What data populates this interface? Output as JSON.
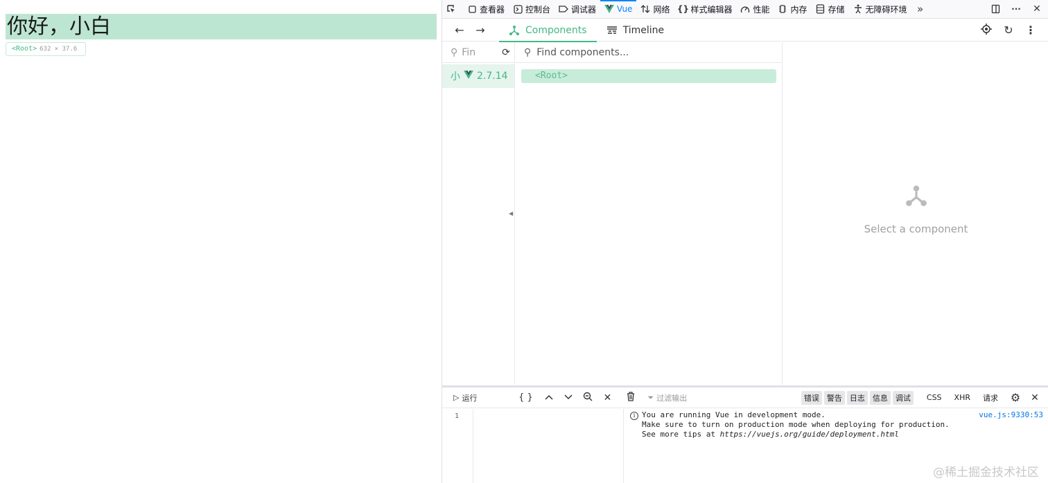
{
  "page": {
    "hello_text": "你好，小白",
    "tooltip": {
      "tag": "<Root>",
      "dims": "632 × 37.6"
    }
  },
  "toolbar": {
    "tabs": [
      {
        "label": "查看器",
        "icon": "inspector-icon"
      },
      {
        "label": "控制台",
        "icon": "console-icon"
      },
      {
        "label": "调试器",
        "icon": "debugger-icon"
      },
      {
        "label": "Vue",
        "icon": "vue-icon",
        "active": true
      },
      {
        "label": "网络",
        "icon": "network-icon"
      },
      {
        "label": "样式编辑器",
        "icon": "style-editor-icon"
      },
      {
        "label": "性能",
        "icon": "performance-icon"
      },
      {
        "label": "内存",
        "icon": "memory-icon"
      },
      {
        "label": "存储",
        "icon": "storage-icon"
      },
      {
        "label": "无障碍环境",
        "icon": "accessibility-icon"
      }
    ]
  },
  "vue_nav": {
    "tabs": [
      {
        "label": "Components",
        "active": true
      },
      {
        "label": "Timeline"
      }
    ]
  },
  "apps": {
    "search_placeholder": "Fin",
    "app_label": "小",
    "app_version": "2.7.14"
  },
  "tree": {
    "search_placeholder": "Find components...",
    "root_node": "<Root>"
  },
  "inspector": {
    "empty_text": "Select a component"
  },
  "console": {
    "run_label": "运行",
    "filter_placeholder": "过滤输出",
    "levels": [
      "错误",
      "警告",
      "日志",
      "信息",
      "调试"
    ],
    "extra_filters": [
      "CSS",
      "XHR",
      "请求"
    ],
    "line_number": "1",
    "message_lines": [
      "You are running Vue in development mode.",
      "Make sure to turn on production mode when deploying for production."
    ],
    "message_tip_prefix": "See more tips at ",
    "message_tip_url": "https://vuejs.org/guide/deployment.html",
    "source": "vue.js:9330:53"
  },
  "watermark": "@稀土掘金技术社区",
  "colors": {
    "vue_green": "#42b883",
    "highlight": "#bde6d2",
    "firefox_blue": "#0a84ff"
  }
}
